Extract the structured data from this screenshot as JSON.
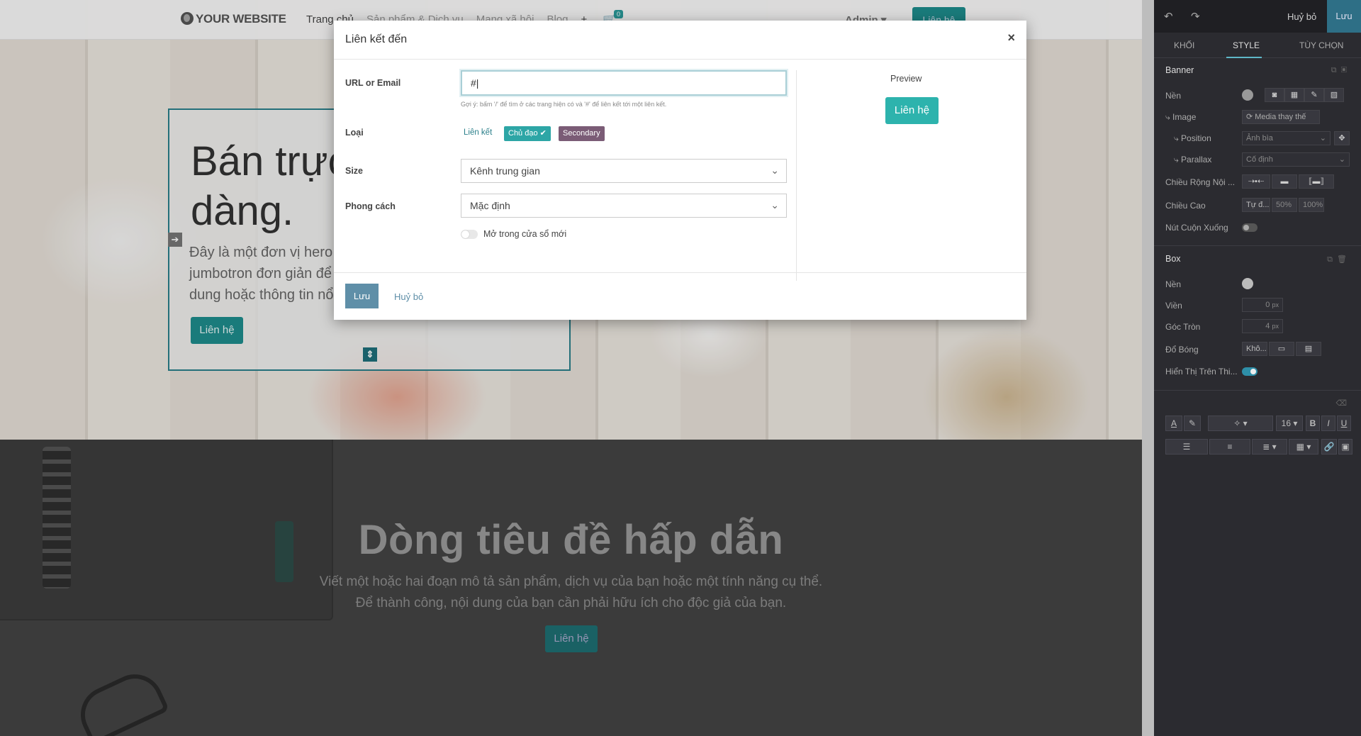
{
  "site": {
    "logo": "YOUR WEBSITE",
    "nav": [
      "Trang chủ",
      "Sản phẩm & Dịch vụ",
      "Mạng xã hội",
      "Blog"
    ],
    "nav_plus": "+",
    "cart_count": "0",
    "admin": "Admin",
    "nav_cta": "Liên hệ",
    "hero_title": "Bán trực tuyến dễ dàng.",
    "hero_text": "Đây là một đơn vị hero đơn giản, một thành phần kiểu jumbotron đơn giản để thu hút sự chú ý đặc biệt đến nội dung hoặc thông tin nổi bật.",
    "hero_button": "Liên hệ",
    "feature_title": "Dòng tiêu đề hấp dẫn",
    "feature_text_1": "Viết một hoặc hai đoạn mô tả sản phẩm, dịch vụ của bạn hoặc một tính năng cụ thể.",
    "feature_text_2": "Để thành công, nội dung của bạn cần phải hữu ích cho độc giả của bạn.",
    "feature_button": "Liên hệ"
  },
  "modal": {
    "title": "Liên kết đến",
    "close": "×",
    "url_label": "URL or Email",
    "url_value": "#",
    "url_hint": "Gợi ý: bấm '/' để tìm ở các trang hiện có và '#' để liên kết tới một liên kết.",
    "type_label": "Loại",
    "type_options": [
      "Liên kết",
      "Chủ đạo ✔",
      "Secondary"
    ],
    "size_label": "Size",
    "size_value": "Kênh trung gian",
    "style_label": "Phong cách",
    "style_value": "Mặc định",
    "new_window_label": "Mở trong cửa sổ mới",
    "preview_label": "Preview",
    "preview_button": "Liên hệ",
    "save": "Lưu",
    "cancel": "Huỷ bỏ"
  },
  "panel": {
    "discard": "Huỷ bỏ",
    "save": "Lưu",
    "tabs": [
      "KHỐI",
      "STYLE",
      "TÙY CHỌN"
    ],
    "banner": {
      "title": "Banner",
      "bg_label": "Nền",
      "image_label": "⤷ Image",
      "media_replace": "⟳ Media thay thế",
      "position_label": "⤷ Position",
      "position_value": "Ảnh bìa",
      "parallax_label": "⤷ Parallax",
      "parallax_value": "Cố định",
      "width_label": "Chiều Rộng Nội ...",
      "height_label": "Chiều Cao",
      "height_options": [
        "Tự đ...",
        "50%",
        "100%"
      ],
      "scroll_label": "Nút Cuộn Xuống"
    },
    "box": {
      "title": "Box",
      "bg_label": "Nền",
      "border_label": "Viền",
      "border_value": "0",
      "radius_label": "Góc Tròn",
      "radius_value": "4",
      "unit": "px",
      "shadow_label": "Đổ Bóng",
      "shadow_value": "Khô...",
      "mobile_label": "Hiển Thị Trên Thi..."
    },
    "format": {
      "font_size": "16",
      "bold": "B",
      "italic": "I",
      "underline": "U"
    }
  }
}
